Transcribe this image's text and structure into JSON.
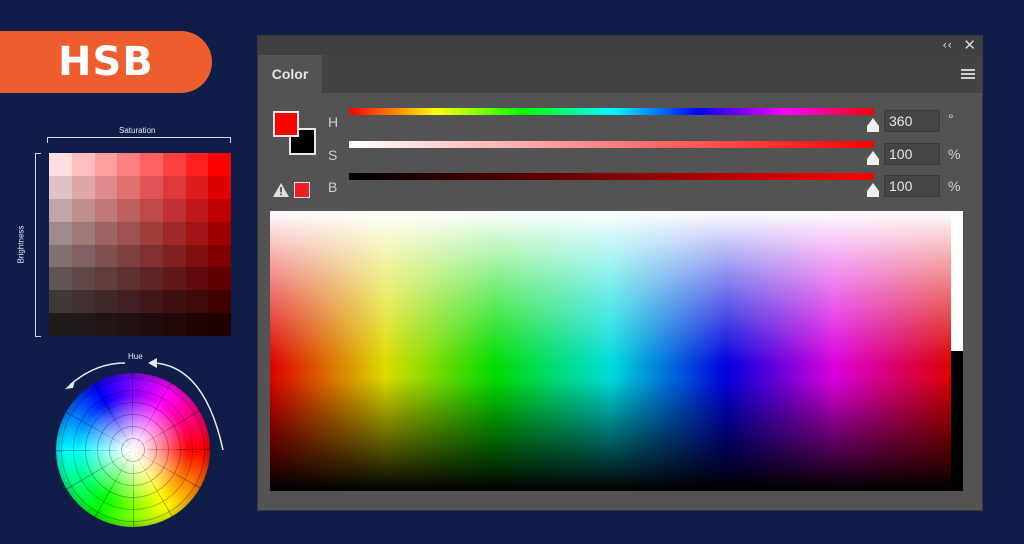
{
  "badge": {
    "label": "HSB"
  },
  "diagram": {
    "saturation_label": "Saturation",
    "brightness_label": "Brightness",
    "hue_label": "Hue",
    "accent_color": "#ee5d2e",
    "background_color": "#0f1d48"
  },
  "panel": {
    "tab_label": "Color",
    "collapse_icon": "double-chevron-left-icon",
    "close_icon": "close-icon",
    "menu_icon": "hamburger-menu-icon",
    "foreground_color": "#ff0000",
    "background_color": "#000000",
    "gamut_warning_icon": "warning-triangle-icon",
    "sliders": [
      {
        "label": "H",
        "value": "360",
        "unit": "°",
        "position": 1.0
      },
      {
        "label": "S",
        "value": "100",
        "unit": "%",
        "position": 1.0
      },
      {
        "label": "B",
        "value": "100",
        "unit": "%",
        "position": 1.0
      }
    ]
  }
}
